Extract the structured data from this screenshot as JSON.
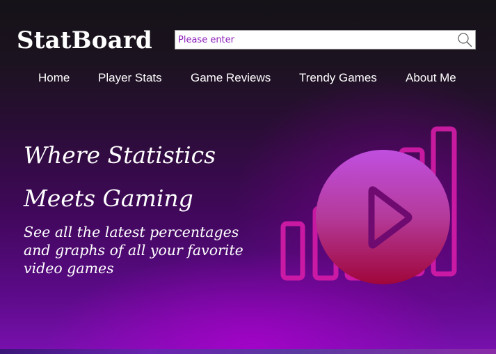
{
  "header": {
    "logo": "StatBoard",
    "search": {
      "placeholder": "Please enter",
      "value": ""
    }
  },
  "nav": {
    "items": [
      {
        "label": "Home"
      },
      {
        "label": "Player Stats"
      },
      {
        "label": "Game Reviews"
      },
      {
        "label": "Trendy Games"
      },
      {
        "label": "About Me"
      }
    ]
  },
  "hero": {
    "headline": "Where Statistics Meets Gaming",
    "subtext": "See all the latest percentages and graphs of all your favorite video games",
    "play_icon": "play-icon",
    "art_icon": "bar-chart-icon"
  },
  "colors": {
    "accent_magenta": "#d61ca8",
    "placeholder_purple": "#8a1ab8",
    "play_top": "#c04fe0",
    "play_bottom": "#a0063a"
  }
}
